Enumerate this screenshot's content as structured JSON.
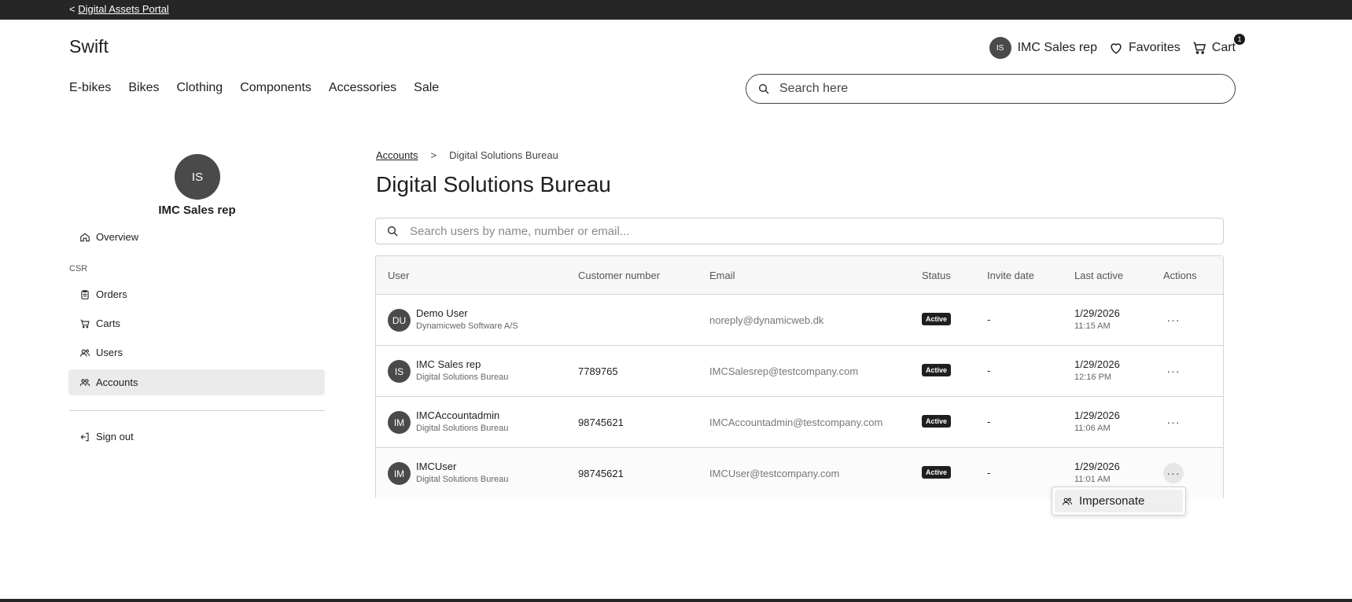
{
  "topbar": {
    "back_prefix": "<",
    "back_link": "Digital Assets Portal"
  },
  "header": {
    "logo": "Swift",
    "user_initials": "IS",
    "user_name": "IMC Sales rep",
    "favorites": "Favorites",
    "cart": "Cart",
    "cart_count": "1"
  },
  "nav": {
    "items": [
      "E-bikes",
      "Bikes",
      "Clothing",
      "Components",
      "Accessories",
      "Sale"
    ]
  },
  "search": {
    "placeholder": "Search here"
  },
  "sidebar": {
    "avatar_initials": "IS",
    "profile_name": "IMC Sales rep",
    "overview": "Overview",
    "section_label": "CSR",
    "orders": "Orders",
    "carts": "Carts",
    "users": "Users",
    "accounts": "Accounts",
    "sign_out": "Sign out"
  },
  "breadcrumb": {
    "root": "Accounts",
    "separator": ">",
    "current": "Digital Solutions Bureau"
  },
  "page": {
    "title": "Digital Solutions Bureau"
  },
  "user_search": {
    "placeholder": "Search users by name, number or email..."
  },
  "table": {
    "headers": [
      "User",
      "Customer number",
      "Email",
      "Status",
      "Invite date",
      "Last active",
      "Actions"
    ],
    "rows": [
      {
        "initials": "DU",
        "name": "Demo User",
        "company": "Dynamicweb Software A/S",
        "number": "",
        "email": "noreply@dynamicweb.dk",
        "status": "Active",
        "invite": "-",
        "date": "1/29/2026",
        "time": "11:15 AM",
        "actions": "···"
      },
      {
        "initials": "IS",
        "name": "IMC Sales rep",
        "company": "Digital Solutions Bureau",
        "number": "7789765",
        "email": "IMCSalesrep@testcompany.com",
        "status": "Active",
        "invite": "-",
        "date": "1/29/2026",
        "time": "12:16 PM",
        "actions": "···"
      },
      {
        "initials": "IM",
        "name": "IMCAccountadmin",
        "company": "Digital Solutions Bureau",
        "number": "98745621",
        "email": "IMCAccountadmin@testcompany.com",
        "status": "Active",
        "invite": "-",
        "date": "1/29/2026",
        "time": "11:06 AM",
        "actions": "···"
      },
      {
        "initials": "IM",
        "name": "IMCUser",
        "company": "Digital Solutions Bureau",
        "number": "98745621",
        "email": "IMCUser@testcompany.com",
        "status": "Active",
        "invite": "-",
        "date": "1/29/2026",
        "time": "11:01 AM",
        "actions": "···"
      }
    ]
  },
  "dropdown": {
    "impersonate": "Impersonate"
  }
}
